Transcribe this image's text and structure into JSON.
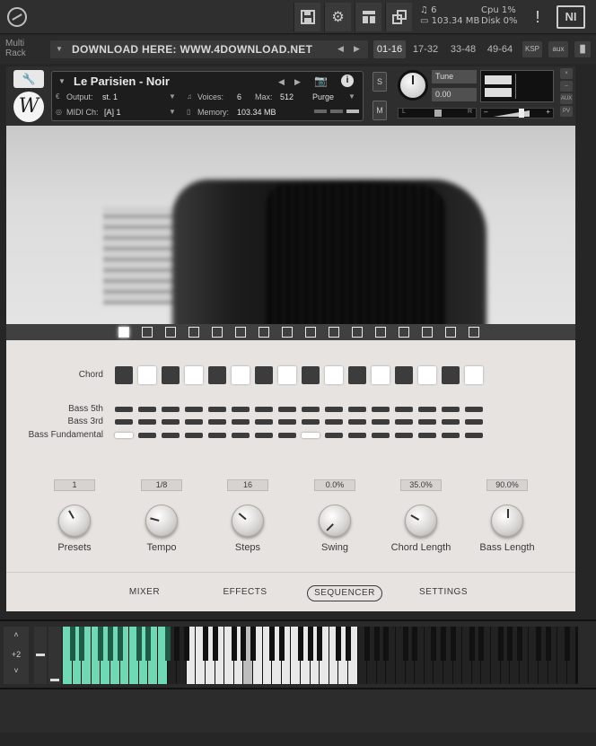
{
  "topbar": {
    "sysinfo": {
      "voices": "6",
      "memory": "103.34 MB",
      "cpu_label": "Cpu",
      "cpu_value": "1%",
      "disk_label": "Disk",
      "disk_value": "0%"
    },
    "warning": "!",
    "ni_logo": "NI"
  },
  "rack": {
    "label": "Multi Rack",
    "download_text": "DOWNLOAD HERE: WWW.4DOWNLOAD.NET",
    "tabs": [
      "01-16",
      "17-32",
      "33-48",
      "49-64"
    ],
    "active_tab": "01-16",
    "buttons": [
      "KSP",
      "aux"
    ]
  },
  "instrument": {
    "name": "Le Parisien - Noir",
    "output_label": "Output:",
    "output_value": "st. 1",
    "voices_label": "Voices:",
    "voices_value": "6",
    "max_label": "Max:",
    "max_value": "512",
    "purge_label": "Purge",
    "midi_label": "MIDI Ch:",
    "midi_value": "[A]  1",
    "memory_label": "Memory:",
    "memory_value": "103.34 MB",
    "solo": "S",
    "mute": "M",
    "tune_label": "Tune",
    "tune_value": "0.00",
    "pan_left": "L",
    "pan_right": "R",
    "side_buttons": [
      "×",
      "–",
      "AUX",
      "PV"
    ],
    "logo_letter": "W"
  },
  "sequencer": {
    "step_active": [
      1,
      0,
      0,
      0,
      0,
      0,
      0,
      0,
      0,
      0,
      0,
      0,
      0,
      0,
      0,
      0
    ],
    "rows": {
      "chord_label": "Chord",
      "bass5_label": "Bass 5th",
      "bass3_label": "Bass 3rd",
      "bassfund_label": "Bass Fundamental"
    },
    "chord": [
      0,
      1,
      0,
      1,
      0,
      1,
      0,
      1,
      0,
      1,
      0,
      1,
      0,
      1,
      0,
      1
    ],
    "bass5": [
      0,
      0,
      0,
      0,
      0,
      0,
      0,
      0,
      0,
      0,
      0,
      0,
      0,
      0,
      0,
      0
    ],
    "bass3": [
      0,
      0,
      0,
      0,
      0,
      0,
      0,
      0,
      0,
      0,
      0,
      0,
      0,
      0,
      0,
      0
    ],
    "bassfund": [
      1,
      0,
      0,
      0,
      0,
      0,
      0,
      0,
      1,
      0,
      0,
      0,
      0,
      0,
      0,
      0
    ],
    "knobs": [
      {
        "label": "Presets",
        "value": "1",
        "rot": -30
      },
      {
        "label": "Tempo",
        "value": "1/8",
        "rot": -75
      },
      {
        "label": "Steps",
        "value": "16",
        "rot": -50
      },
      {
        "label": "Swing",
        "value": "0.0%",
        "rot": -135
      },
      {
        "label": "Chord Length",
        "value": "35.0%",
        "rot": -60
      },
      {
        "label": "Bass Length",
        "value": "90.0%",
        "rot": 0
      }
    ]
  },
  "tabs": {
    "items": [
      "MIXER",
      "EFFECTS",
      "SEQUENCER",
      "SETTINGS"
    ],
    "active": "SEQUENCER"
  },
  "keyboard": {
    "octave": "+2",
    "keyswitch_color": "#6fd9b5"
  }
}
